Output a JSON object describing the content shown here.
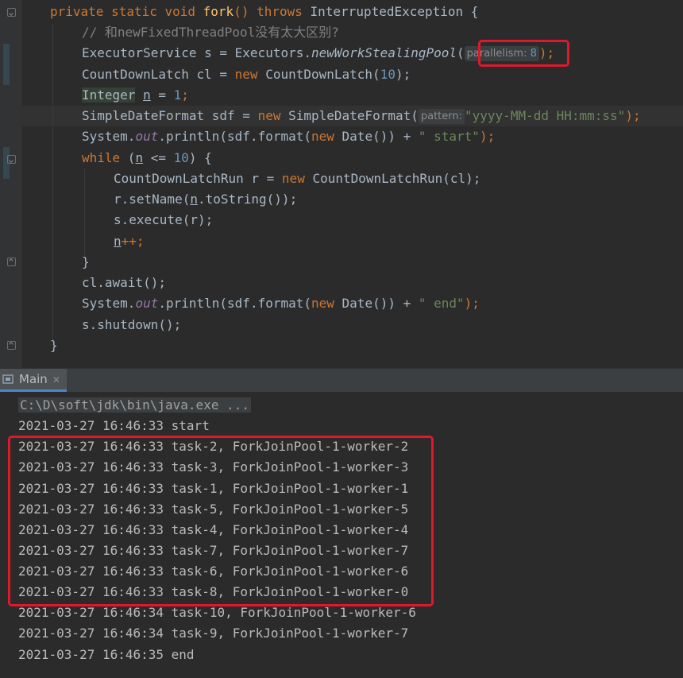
{
  "editor": {
    "lines": [
      {
        "parts": [
          "private static void ",
          "fork",
          "() throws ",
          "InterruptedException {"
        ]
      },
      {
        "comment": "// 和newFixedThreadPool没有太大区别?"
      },
      {
        "a": "ExecutorService s = Executors.",
        "b": "newWorkStealingPool",
        "c": "(",
        "hint": "parallelism:",
        "num": "8",
        "d": ");"
      },
      {
        "a": "CountDownLatch cl = ",
        "kw": "new",
        "b": " CountDownLatch(",
        "num": "10",
        "c": ");"
      },
      {
        "a": "Integer",
        "b": " ",
        "var": "n",
        "c": " = ",
        "num": "1",
        "d": ";"
      },
      {
        "a": "SimpleDateFormat sdf = ",
        "kw": "new",
        "b": " SimpleDateFormat(",
        "hint": "pattern:",
        "str": "\"yyyy-MM-dd HH:mm:ss\"",
        "c": ");"
      },
      {
        "a": "System.",
        "fld": "out",
        "b": ".println(sdf.format(",
        "kw": "new",
        "c": " Date()) + ",
        "str": "\" start\"",
        "d": ");"
      },
      {
        "kw": "while",
        "a": " (",
        "var": "n",
        "b": " <= ",
        "num": "10",
        "c": ") {"
      },
      {
        "a": "CountDownLatchRun r = ",
        "kw": "new",
        "b": " CountDownLatchRun(cl);"
      },
      {
        "a": "r.setName(",
        "var": "n",
        "b": ".toString());"
      },
      {
        "a": "s.execute(r);"
      },
      {
        "var": "n",
        "a": "++;"
      },
      {
        "a": "}"
      },
      {
        "a": "cl.await();"
      },
      {
        "a": "System.",
        "fld": "out",
        "b": ".println(sdf.format(",
        "kw": "new",
        "c": " Date()) + ",
        "str": "\" end\"",
        "d": ");"
      },
      {
        "a": "s.shutdown();"
      },
      {
        "a": "}"
      }
    ]
  },
  "run_panel": {
    "tab_label": "Main",
    "close_glyph": "✕"
  },
  "console": {
    "command": "C:\\D\\soft\\jdk\\bin\\java.exe ...",
    "lines": [
      "2021-03-27 16:46:33 start",
      "2021-03-27 16:46:33 task-2, ForkJoinPool-1-worker-2",
      "2021-03-27 16:46:33 task-3, ForkJoinPool-1-worker-3",
      "2021-03-27 16:46:33 task-1, ForkJoinPool-1-worker-1",
      "2021-03-27 16:46:33 task-5, ForkJoinPool-1-worker-5",
      "2021-03-27 16:46:33 task-4, ForkJoinPool-1-worker-4",
      "2021-03-27 16:46:33 task-7, ForkJoinPool-1-worker-7",
      "2021-03-27 16:46:33 task-6, ForkJoinPool-1-worker-6",
      "2021-03-27 16:46:33 task-8, ForkJoinPool-1-worker-0",
      "2021-03-27 16:46:34 task-10, ForkJoinPool-1-worker-6",
      "2021-03-27 16:46:34 task-9, ForkJoinPool-1-worker-7",
      "2021-03-27 16:46:35 end"
    ]
  },
  "colors": {
    "keyword": "#cc7832",
    "method": "#ffc66d",
    "number": "#6897bb",
    "string": "#6a8759",
    "annotation_box": "#e0182a"
  }
}
